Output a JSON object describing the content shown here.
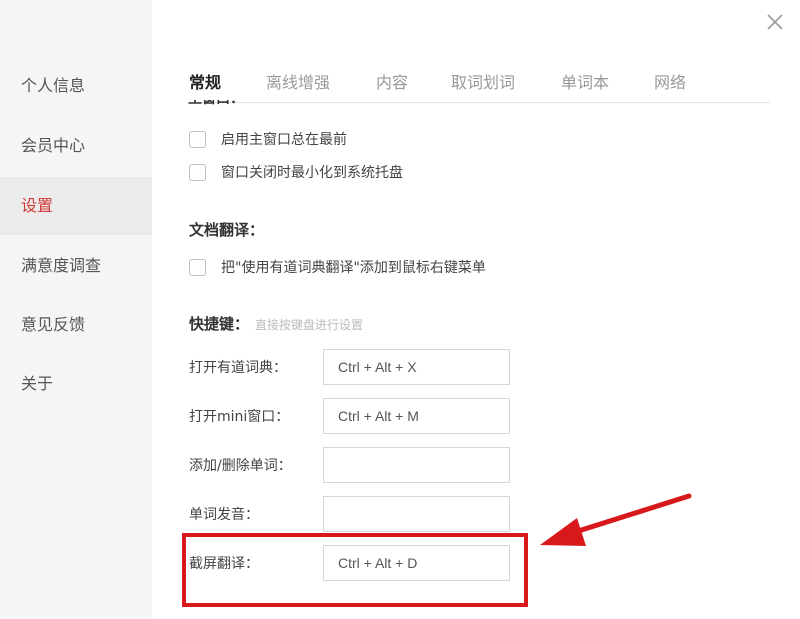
{
  "sidebar": {
    "items": [
      {
        "label": "个人信息"
      },
      {
        "label": "会员中心"
      },
      {
        "label": "设置",
        "active": true
      },
      {
        "label": "满意度调查"
      },
      {
        "label": "意见反馈"
      },
      {
        "label": "关于"
      }
    ]
  },
  "tabs": [
    {
      "label": "常规",
      "active": true
    },
    {
      "label": "离线增强"
    },
    {
      "label": "内容"
    },
    {
      "label": "取词划词"
    },
    {
      "label": "单词本"
    },
    {
      "label": "网络"
    }
  ],
  "main_window": {
    "cut_heading": "主窗口：",
    "options": [
      {
        "label": "启用主窗口总在最前",
        "checked": false
      },
      {
        "label": "窗口关闭时最小化到系统托盘",
        "checked": false
      }
    ]
  },
  "doc_translate": {
    "title": "文档翻译：",
    "options": [
      {
        "label": "把\"使用有道词典翻译\"添加到鼠标右键菜单",
        "checked": false
      }
    ]
  },
  "shortcuts": {
    "title": "快捷键：",
    "hint": "直接按键盘进行设置",
    "items": [
      {
        "label": "打开有道词典：",
        "value": "Ctrl + Alt + X"
      },
      {
        "label": "打开mini窗口：",
        "value": "Ctrl + Alt + M"
      },
      {
        "label": "添加/删除单词：",
        "value": ""
      },
      {
        "label": "单词发音：",
        "value": ""
      },
      {
        "label": "截屏翻译：",
        "value": "Ctrl + Alt + D"
      }
    ]
  },
  "colors": {
    "accent": "#d03a3a",
    "annotation": "#d7191b"
  },
  "icons": {
    "close": "close-icon",
    "checkbox": "checkbox-icon",
    "annotation_arrow": "arrow-icon"
  }
}
